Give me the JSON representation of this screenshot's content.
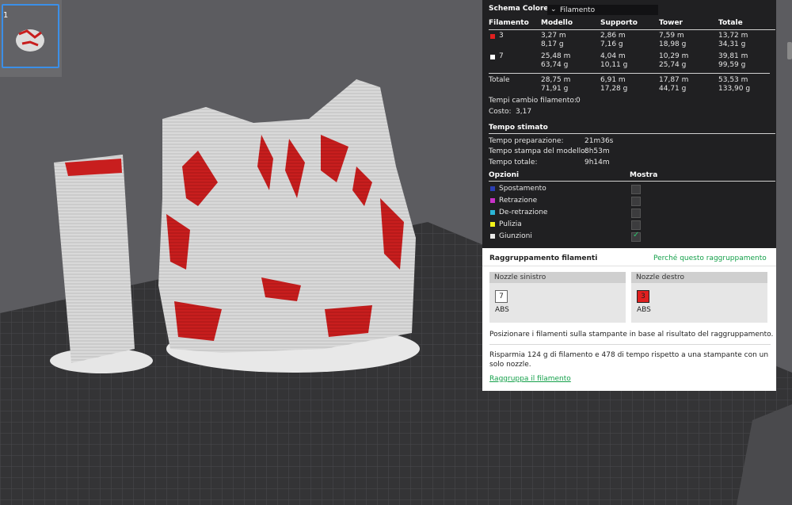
{
  "thumbnail": {
    "plate_number": "1"
  },
  "color_scheme": {
    "label": "Schema Colore",
    "value": "Filamento"
  },
  "filament_table": {
    "headers": [
      "Filamento",
      "Modello",
      "Supporto",
      "Tower",
      "Totale"
    ],
    "rows": [
      {
        "swatch": "#e02020",
        "id": "3",
        "modello": [
          "3,27 m",
          "8,17 g"
        ],
        "supporto": [
          "2,86 m",
          "7,16 g"
        ],
        "tower": [
          "7,59 m",
          "18,98 g"
        ],
        "totale": [
          "13,72 m",
          "34,31 g"
        ]
      },
      {
        "swatch": "#ffffff",
        "id": "7",
        "modello": [
          "25,48 m",
          "63,74 g"
        ],
        "supporto": [
          "4,04 m",
          "10,11 g"
        ],
        "tower": [
          "10,29 m",
          "25,74 g"
        ],
        "totale": [
          "39,81 m",
          "99,59 g"
        ]
      }
    ],
    "total_row": {
      "label": "Totale",
      "modello": [
        "28,75 m",
        "71,91 g"
      ],
      "supporto": [
        "6,91 m",
        "17,28 g"
      ],
      "tower": [
        "17,87 m",
        "44,71 g"
      ],
      "totale": [
        "53,53 m",
        "133,90 g"
      ]
    }
  },
  "filament_change": {
    "label": "Tempi cambio filamento:",
    "value": "0"
  },
  "cost": {
    "label": "Costo:",
    "value": "3,17"
  },
  "estimated_time": {
    "title": "Tempo stimato",
    "rows": [
      {
        "label": "Tempo preparazione:",
        "value": "21m36s"
      },
      {
        "label": "Tempo stampa del modello:",
        "value": "8h53m"
      },
      {
        "label": "Tempo totale:",
        "value": "9h14m"
      }
    ]
  },
  "options": {
    "header_left": "Opzioni",
    "header_right": "Mostra",
    "items": [
      {
        "label": "Spostamento",
        "color": "#2c3fb3",
        "checked": false
      },
      {
        "label": "Retrazione",
        "color": "#c832c8",
        "checked": false
      },
      {
        "label": "De-retrazione",
        "color": "#2bb5d6",
        "checked": false
      },
      {
        "label": "Pulizia",
        "color": "#f2f21a",
        "checked": false
      },
      {
        "label": "Giunzioni",
        "color": "#e8e8e8",
        "checked": true
      }
    ]
  },
  "grouping": {
    "title": "Raggruppamento filamenti",
    "link": "Perché questo raggruppamento",
    "left_nozzle": {
      "title": "Nozzle sinistro",
      "filament": "7",
      "material": "ABS"
    },
    "right_nozzle": {
      "title": "Nozzle destro",
      "filament": "3",
      "material": "ABS"
    },
    "description": "Posizionare i filamenti sulla stampante in base al risultato del raggruppamento.",
    "savings": "Risparmia 124 g di filamento e 478 di tempo rispetto a una stampante con un solo nozzle.",
    "action": "Raggruppa il filamento"
  },
  "colors": {
    "accent_green": "#14a04a",
    "model_red": "#c81e1e"
  }
}
